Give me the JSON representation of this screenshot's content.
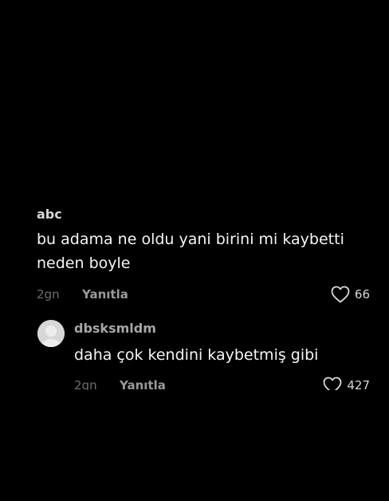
{
  "comments": [
    {
      "username": "abc",
      "text": "bu adama ne oldu yani birini mi kaybetti neden boyle",
      "time": "2gn",
      "reply_label": "Yanıtla",
      "likes": "66"
    }
  ],
  "reply": {
    "username": "dbsksmldm",
    "text": "daha çok kendini kaybetmiş gibi",
    "time": "2gn",
    "reply_label": "Yanıtla",
    "likes": "427"
  },
  "icons": {
    "like": "heart-outline-icon",
    "avatar": "default-avatar-icon"
  },
  "colors": {
    "background": "#000000",
    "text": "#f5f5f5",
    "muted": "#6d6d6d",
    "reply": "#9a9a9a"
  }
}
